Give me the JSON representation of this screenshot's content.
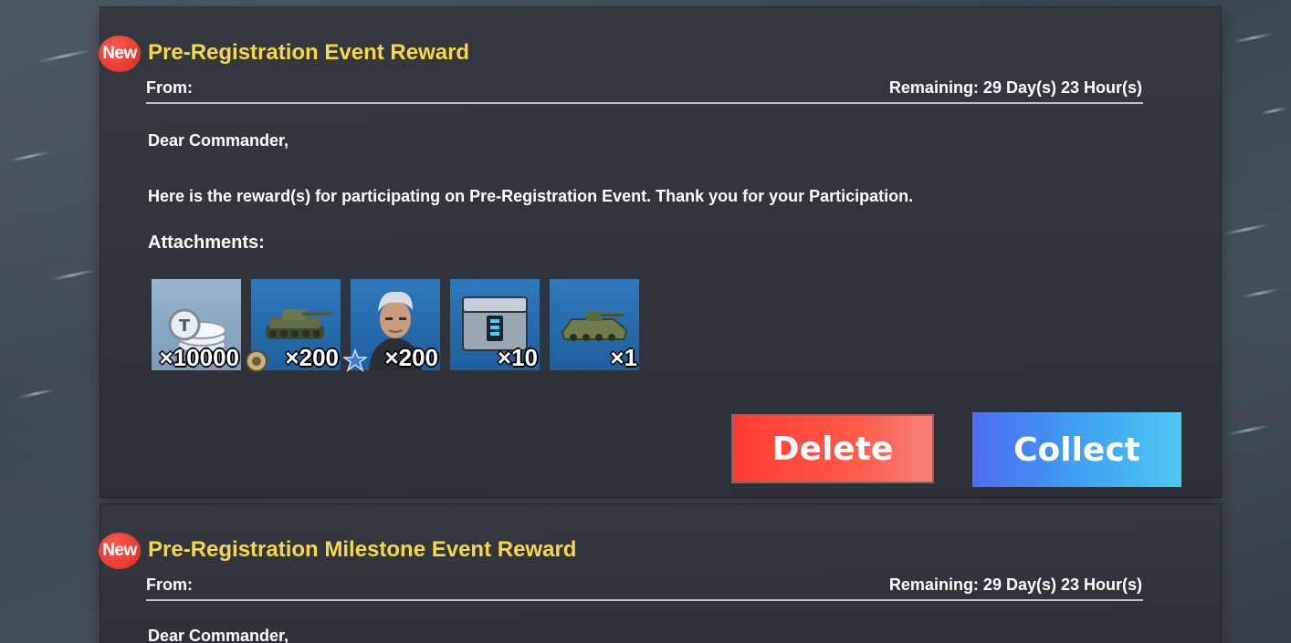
{
  "mails": [
    {
      "badge": "New",
      "title": "Pre-Registration Event Reward",
      "from_label": "From:",
      "remaining": "Remaining: 29 Day(s) 23 Hour(s)",
      "greeting": "Dear Commander,",
      "message": "Here is the reward(s) for participating on Pre-Registration Event. Thank you for your Participation.",
      "attachments_label": "Attachments:",
      "attachments": [
        {
          "icon": "silver-coins-icon",
          "qty": "×10000"
        },
        {
          "icon": "tank-icon",
          "qty": "×200"
        },
        {
          "icon": "commander-portrait-icon",
          "qty": "×200"
        },
        {
          "icon": "supply-crate-icon",
          "qty": "×10"
        },
        {
          "icon": "armored-vehicle-icon",
          "qty": "×1"
        }
      ],
      "delete_label": "Delete",
      "collect_label": "Collect"
    },
    {
      "badge": "New",
      "title": "Pre-Registration Milestone Event Reward",
      "from_label": "From:",
      "remaining": "Remaining: 29 Day(s) 23 Hour(s)",
      "greeting": "Dear Commander,"
    }
  ],
  "colors": {
    "title": "#f5d84a",
    "badge": "#e5342a",
    "delete": "#ff3b30",
    "collect": "#3fa4f3"
  }
}
